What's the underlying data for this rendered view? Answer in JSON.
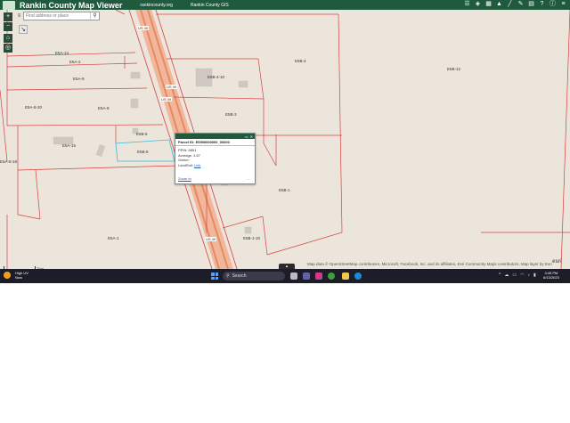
{
  "header": {
    "title": "Rankin County Map Viewer",
    "links": [
      "rankincounty.org",
      "Rankin County GIS"
    ],
    "tool_icons": [
      "layers-icon",
      "basemap-icon",
      "grid-icon",
      "alert-icon",
      "measure-icon",
      "draw-icon",
      "print-icon",
      "help-icon",
      "info-icon",
      "menu-icon"
    ]
  },
  "search": {
    "placeholder": "Find address or place"
  },
  "map": {
    "road_labels": [
      "US 49",
      "US 49",
      "US 49",
      "US 49",
      "US 49"
    ],
    "parcel_labels": [
      "E5A-14",
      "E5A-2",
      "E5A-9",
      "E5A-8-20",
      "E5A-8",
      "E5A-15",
      "E5A-8-18",
      "E5B-4-10",
      "E5B-3",
      "E5B-4",
      "E5B-12",
      "E5B-5",
      "E5B-6",
      "E5B-1",
      "E5B-1-10",
      "E5A-1"
    ],
    "scale_label": "20m",
    "attribution": "Map data © OpenStreetMap contributors, Microsoft, Facebook, Inc. and its affiliates, Esri Community Maps contributors, Map layer by Esri",
    "esri_logo": "esri"
  },
  "popup": {
    "title": "Parcel ID: E0590000000_00000",
    "ppin_label": "PPIN: 6851",
    "acreage_label": "Acreage: 3.67",
    "owner_label": "Owner:",
    "landroll_label": "LandRoll:",
    "landroll_link": "Link",
    "zoom_link": "Zoom to",
    "more": "...",
    "accent_color": "#1f5a3e"
  },
  "taskbar": {
    "weather_line1": "High UV",
    "weather_line2": "Now",
    "search_label": "Search",
    "time": "3:45 PM",
    "date": "6/13/2023"
  }
}
